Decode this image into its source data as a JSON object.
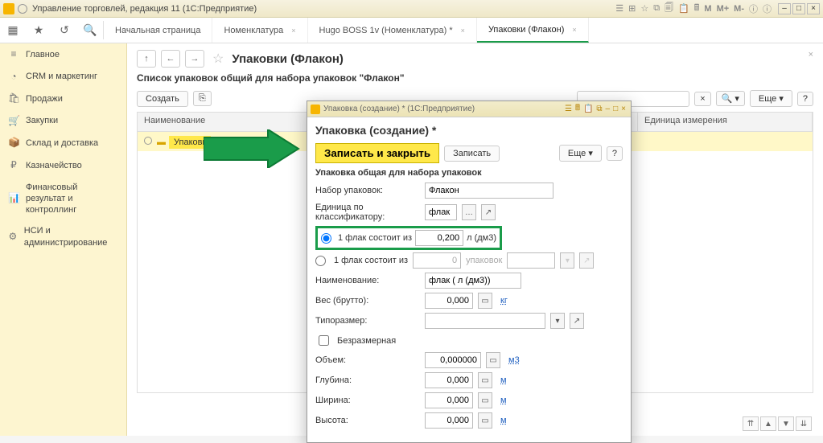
{
  "titlebar": {
    "title": "Управление торговлей, редакция 11  (1С:Предприятие)"
  },
  "titlebar_letters": [
    "М",
    "М+",
    "М-"
  ],
  "tabs": [
    {
      "label": "Начальная страница"
    },
    {
      "label": "Номенклатура",
      "closable": true
    },
    {
      "label": "Hugo BOSS 1v (Номенклатура) *",
      "closable": true
    },
    {
      "label": "Упаковки (Флакон)",
      "closable": true,
      "active": true
    }
  ],
  "sidebar": {
    "items": [
      {
        "icon": "≡",
        "label": "Главное"
      },
      {
        "icon": "◔",
        "label": "CRM и маркетинг"
      },
      {
        "icon": "🛍",
        "label": "Продажи"
      },
      {
        "icon": "🛒",
        "label": "Закупки"
      },
      {
        "icon": "📦",
        "label": "Склад и доставка"
      },
      {
        "icon": "₽",
        "label": "Казначейство"
      },
      {
        "icon": "📊",
        "label": "Финансовый результат и контроллинг"
      },
      {
        "icon": "⚙",
        "label": "НСИ и администрирование"
      }
    ]
  },
  "page": {
    "title": "Упаковки (Флакон)",
    "subtitle": "Список упаковок общий для набора упаковок \"Флакон\"",
    "create": "Создать",
    "more": "Еще",
    "search_placeholder": "",
    "grid": {
      "col_name": "Наименование",
      "col_unit": "Единица измерения",
      "rows": [
        {
          "name": "Упаковк"
        }
      ]
    }
  },
  "modal": {
    "window_title": "Упаковка (создание) *  (1С:Предприятие)",
    "title": "Упаковка (создание) *",
    "save_close": "Записать и закрыть",
    "save": "Записать",
    "more": "Еще",
    "help": "?",
    "section": "Упаковка общая для набора упаковок",
    "set_label": "Набор упаковок:",
    "set_value": "Флакон",
    "classifier_label": "Единица по классификатору:",
    "classifier_value": "флак",
    "radio1_text": "1 флак состоит из",
    "radio1_value": "0,200",
    "radio1_unit": "л (дм3)",
    "radio2_text": "1 флак состоит из",
    "radio2_value": "0",
    "radio2_unit": "упаковок",
    "name_label": "Наименование:",
    "name_value": "флак ( л (дм3))",
    "weight_label": "Вес (брутто):",
    "weight_value": "0,000",
    "weight_unit": "кг",
    "size_label": "Типоразмер:",
    "dimless": "Безразмерная",
    "volume_label": "Объем:",
    "volume_value": "0,000000",
    "volume_unit": "м3",
    "depth_label": "Глубина:",
    "depth_value": "0,000",
    "depth_unit": "м",
    "width_label": "Ширина:",
    "width_value": "0,000",
    "width_unit": "м",
    "height_label": "Высота:",
    "height_value": "0,000",
    "height_unit": "м"
  }
}
